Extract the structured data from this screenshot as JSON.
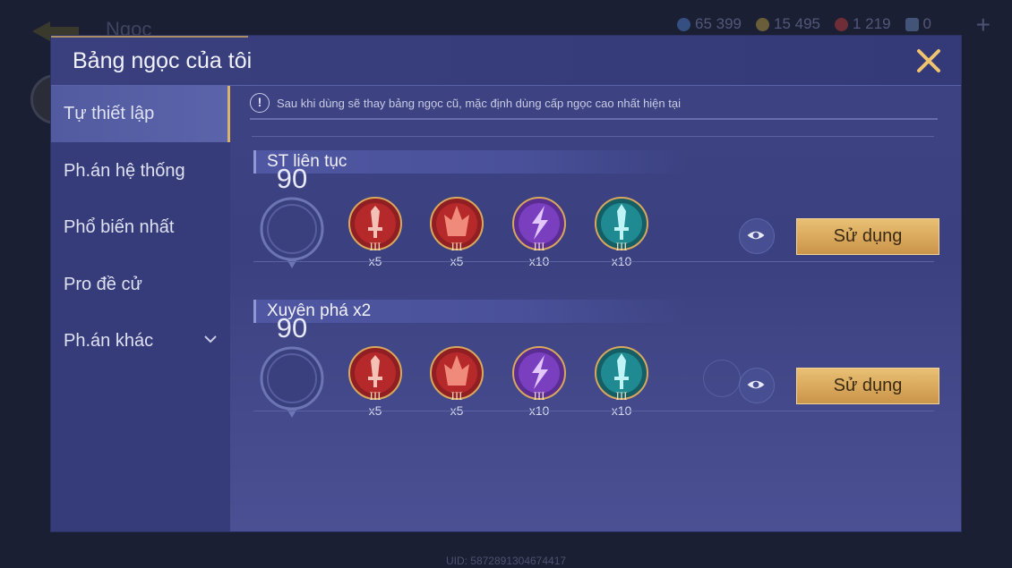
{
  "background": {
    "title": "Ngọc",
    "currencies": [
      {
        "icon": "gem-currency-icon",
        "value": "65 399",
        "color": "#4a6fb5"
      },
      {
        "icon": "gold-coin-icon",
        "value": "15 495",
        "color": "#a0873d"
      },
      {
        "icon": "ruby-icon",
        "value": "1 219",
        "color": "#a8383a"
      },
      {
        "icon": "voucher-icon",
        "value": "0",
        "color": "#5f78a8"
      }
    ],
    "uid": "UID: 5872891304674417"
  },
  "dialog": {
    "title": "Bảng ngọc của tôi",
    "close_icon": "close-icon"
  },
  "sidebar": {
    "items": [
      {
        "label": "Tự thiết lập",
        "active": true
      },
      {
        "label": "Ph.án hệ thống",
        "active": false
      },
      {
        "label": "Phổ biến nhất",
        "active": false
      },
      {
        "label": "Pro đề cử",
        "active": false
      },
      {
        "label": "Ph.án khác",
        "active": false,
        "has_dropdown": true
      }
    ]
  },
  "notice": {
    "icon": "info-icon",
    "text": "Sau khi dùng sẽ thay bảng ngọc cũ, mặc định dùng cấp ngọc cao nhất hiện tại"
  },
  "sets": [
    {
      "name": "ST liên tục",
      "level": "90",
      "gems": [
        {
          "color": "red",
          "icon": "red-sword-gem-icon",
          "tier": "III",
          "count": "x5"
        },
        {
          "color": "red",
          "icon": "red-crown-gem-icon",
          "tier": "III",
          "count": "x5"
        },
        {
          "color": "purple",
          "icon": "purple-lightning-gem-icon",
          "tier": "III",
          "count": "x10"
        },
        {
          "color": "teal",
          "icon": "teal-sword-gem-icon",
          "tier": "III",
          "count": "x10"
        }
      ],
      "use_label": "Sử dụng"
    },
    {
      "name": "Xuyên phá x2",
      "level": "90",
      "gems": [
        {
          "color": "red",
          "icon": "red-sword-gem-icon",
          "tier": "III",
          "count": "x5"
        },
        {
          "color": "red",
          "icon": "red-crown-gem-icon",
          "tier": "III",
          "count": "x5"
        },
        {
          "color": "purple",
          "icon": "purple-lightning-gem-icon",
          "tier": "III",
          "count": "x10"
        },
        {
          "color": "teal",
          "icon": "teal-sword-gem-icon",
          "tier": "III",
          "count": "x10"
        }
      ],
      "use_label": "Sử dụng"
    }
  ],
  "colors": {
    "accent_gold": "#d9a85c",
    "panel": "#3c4283",
    "gem_red": "#b5292b",
    "gem_purple": "#7a3fbf",
    "gem_teal": "#1f8a92"
  }
}
